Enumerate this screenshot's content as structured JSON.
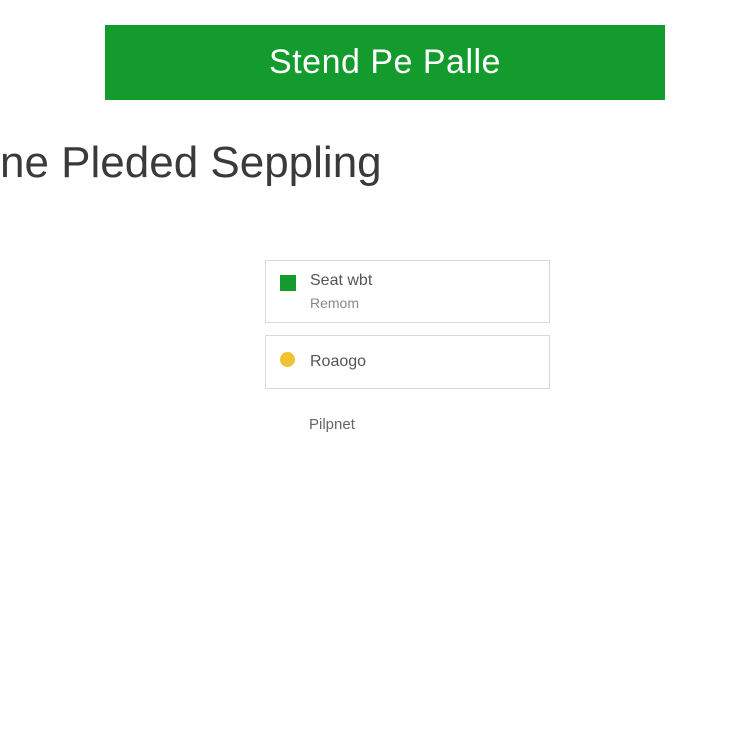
{
  "header": {
    "title": "Stend Pe Palle"
  },
  "subtitle": "ne Pleded Seppling",
  "options": {
    "item1": {
      "primary": "Seat wbt",
      "secondary": "Remom"
    },
    "item2": {
      "primary": "Roaogo"
    },
    "item3": {
      "primary": "Pilpnet"
    }
  },
  "colors": {
    "accent": "#149b2e",
    "warn": "#f1c232"
  }
}
